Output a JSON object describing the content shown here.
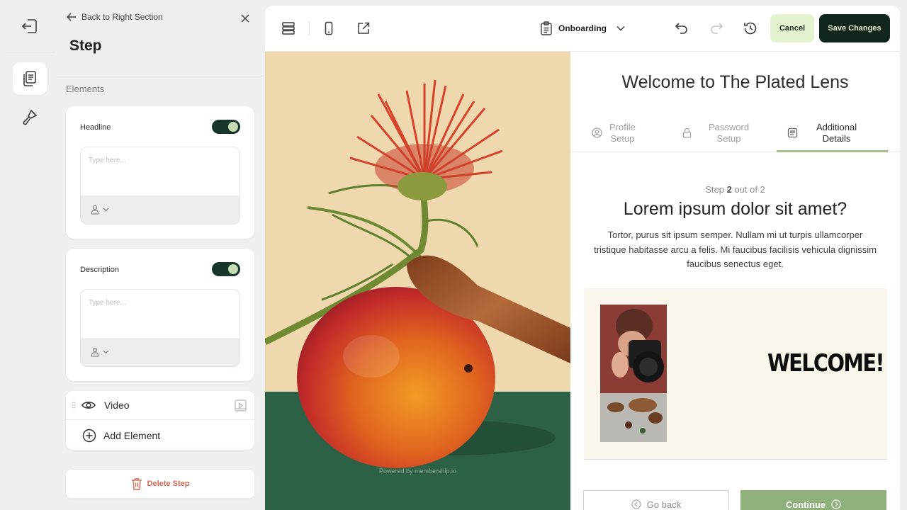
{
  "panel": {
    "back_label": "Back to Right Section",
    "title": "Step",
    "section_label": "Elements",
    "headline": {
      "label": "Headline",
      "enabled": true,
      "placeholder": "Type here..."
    },
    "description": {
      "label": "Description",
      "enabled": true,
      "placeholder": "Type here..."
    },
    "elements": [
      {
        "label": "Video",
        "icon": "eye-icon"
      },
      {
        "label": "Add Element",
        "icon": "plus-circle-icon"
      }
    ],
    "delete_label": "Delete Step"
  },
  "toolbar": {
    "flow_name": "Onboarding",
    "cancel_label": "Cancel",
    "save_label": "Save Changes"
  },
  "preview": {
    "title": "Welcome to The Plated Lens",
    "tabs": [
      {
        "label_line1": "Profile",
        "label_line2": "Setup",
        "active": false
      },
      {
        "label_line1": "Password",
        "label_line2": "Setup",
        "active": false
      },
      {
        "label_line1": "Additional",
        "label_line2": "Details",
        "active": true
      }
    ],
    "step_prefix": "Step",
    "step_current": "2",
    "step_suffix": "out of 2",
    "question": "Lorem ipsum dolor sit amet?",
    "description": "Tortor, purus sit ipsum semper. Nullam mi ut turpis ullamcorper tristique habitasse arcu a felis. Mi faucibus facilisis vehicula dignissim faucibus senectus eget.",
    "video_overlay_text": "WELCOME!",
    "back_label": "Go back",
    "continue_label": "Continue",
    "powered_by": "Powered by",
    "powered_brand": "membership.io"
  },
  "colors": {
    "primary_dark": "#10261d",
    "accent_light": "#e3f2cf",
    "continue_green": "#8fb07a",
    "danger": "#cf6a57"
  }
}
